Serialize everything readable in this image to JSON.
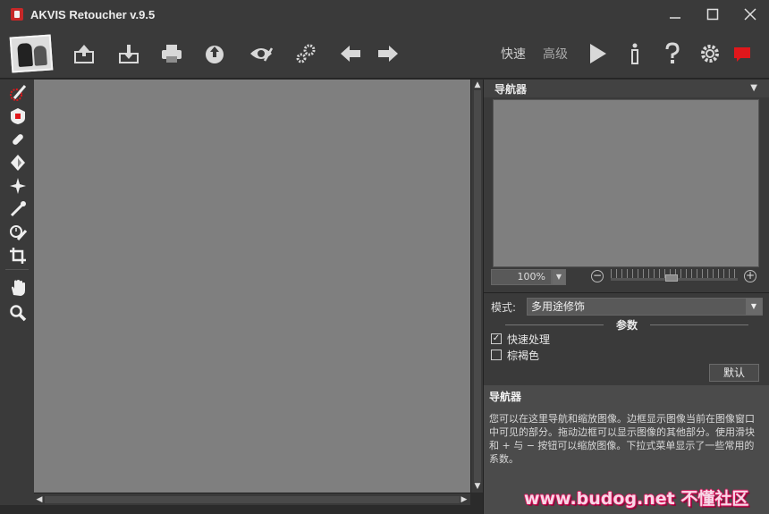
{
  "window": {
    "title": "AKVIS Retoucher v.9.5",
    "controls": {
      "minimize": "—",
      "maximize": "☐",
      "close": "✕"
    }
  },
  "toolbar": {
    "icons": [
      "photo-thumbnail-icon",
      "open-image-icon",
      "save-image-icon",
      "print-icon",
      "share-icon",
      "preview-eye-icon",
      "batch-gears-icon",
      "undo-arrow-icon",
      "redo-arrow-icon",
      "run-icon",
      "info-icon",
      "help-icon",
      "settings-gear-icon",
      "feedback-icon"
    ],
    "mode_express": "快速",
    "mode_advanced": "高级"
  },
  "tools": [
    "retouch-brush-icon",
    "patch-icon",
    "clone-stamp-icon",
    "chameleon-brush-icon",
    "healing-star-icon",
    "smudge-brush-icon",
    "history-brush-icon",
    "crop-icon",
    "hand-icon",
    "zoom-icon"
  ],
  "navigator": {
    "title": "导航器",
    "zoom_value": "100%"
  },
  "settings": {
    "mode_label": "模式:",
    "mode_value": "多用途修饰",
    "params_title": "参数",
    "fast_processing": {
      "label": "快速处理",
      "checked": true
    },
    "brown_color": {
      "label": "棕褐色",
      "checked": false
    },
    "default_button": "默认"
  },
  "help": {
    "title": "导航器",
    "body": "您可以在这里导航和缩放图像。边框显示图像当前在图像窗口中可见的部分。拖动边框可以显示图像的其他部分。使用滑块和 + 与 − 按钮可以缩放图像。下拉式菜单显示了一些常用的系数。"
  },
  "watermark": "www.budog.net 不懂社区",
  "colors": {
    "accent_red": "#e0171b",
    "canvas": "#7f7f7f",
    "chrome": "#3a3a3a"
  }
}
